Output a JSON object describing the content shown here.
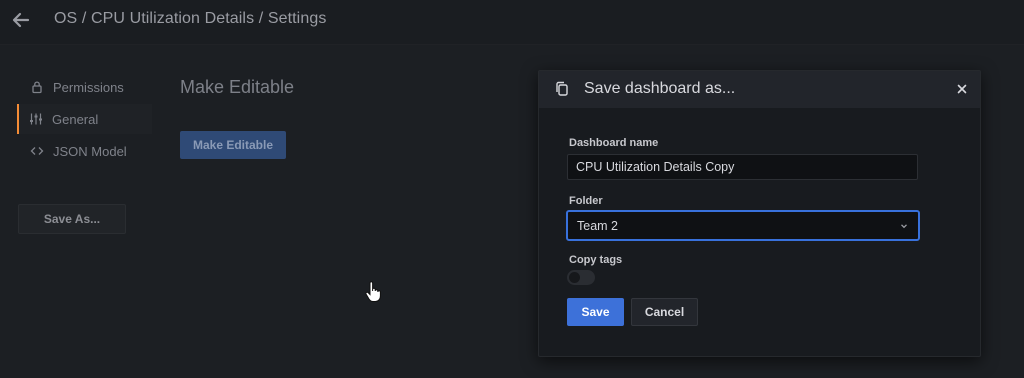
{
  "header": {
    "breadcrumb": "OS / CPU Utilization Details / Settings",
    "back_icon": "arrow-left-icon"
  },
  "sidebar": {
    "items": [
      {
        "label": "Permissions",
        "icon": "lock-icon",
        "active": false
      },
      {
        "label": "General",
        "icon": "sliders-icon",
        "active": true
      },
      {
        "label": "JSON Model",
        "icon": "code-brackets-icon",
        "active": false
      }
    ],
    "save_as_label": "Save As..."
  },
  "main": {
    "title": "Make Editable",
    "make_editable_label": "Make Editable"
  },
  "modal": {
    "title": "Save dashboard as...",
    "dashboard_name_label": "Dashboard name",
    "dashboard_name_value": "CPU Utilization Details Copy",
    "folder_label": "Folder",
    "folder_value": "Team 2",
    "copy_tags_label": "Copy tags",
    "copy_tags_on": false,
    "save_label": "Save",
    "cancel_label": "Cancel"
  },
  "colors": {
    "accent_active": "#f58c36",
    "primary_button": "#3d71d9",
    "focus_border": "#3871dc"
  }
}
